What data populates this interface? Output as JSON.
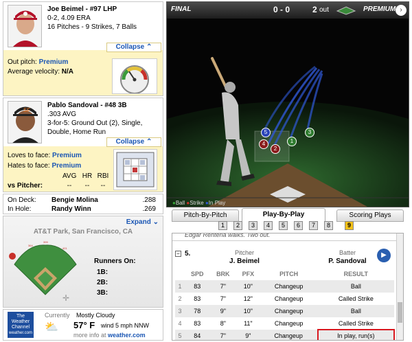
{
  "pitcher": {
    "name": "Joe Beimel - #97 LHP",
    "record": "0-2, 4.09 ERA",
    "pitches": "16 Pitches - 9 Strikes, 7 Balls",
    "collapse": "Collapse",
    "out_pitch_label": "Out pitch:",
    "out_pitch_value": "Premium",
    "velocity_label": "Average velocity:",
    "velocity_value": "N/A"
  },
  "batter": {
    "name": "Pablo Sandoval - #48 3B",
    "avg": ".303 AVG",
    "line1": "3-for-5: Ground Out (2), Single,",
    "line2": "Double, Home Run",
    "collapse": "Collapse",
    "loves_label": "Loves to face:",
    "loves_value": "Premium",
    "hates_label": "Hates to face:",
    "hates_value": "Premium",
    "stat_headers": [
      "AVG",
      "HR",
      "RBI"
    ],
    "vs_label": "vs Pitcher:",
    "vs_values": [
      "--",
      "--",
      "--"
    ]
  },
  "on_deck": {
    "label": "On Deck:",
    "name": "Bengie Molina",
    "avg": ".288"
  },
  "in_hole": {
    "label": "In Hole:",
    "name": "Randy Winn",
    "avg": ".269"
  },
  "park": {
    "expand": "Expand",
    "name": "AT&T Park, San Francisco, CA",
    "runners_title": "Runners On:",
    "bases": [
      "1B:",
      "2B:",
      "3B:"
    ]
  },
  "weather": {
    "logo_line1": "The",
    "logo_line2": "Weather",
    "logo_line3": "Channel",
    "logo_url": "weather.com",
    "currently": "Currently",
    "condition": "Mostly Cloudy",
    "temp": "57° F",
    "wind": "wind 5 mph NNW",
    "more_prefix": "more info at",
    "more_link": "weather.com"
  },
  "game": {
    "status": "FINAL",
    "score": "0 - 0",
    "outs": "2",
    "outs_label": "out",
    "premium": "PREMIUM"
  },
  "pitch_markers": [
    "1",
    "2",
    "3",
    "4",
    "5"
  ],
  "legend": [
    "Ball",
    "Strike",
    "In Play"
  ],
  "tabs": [
    "Pitch-By-Pitch",
    "Play-By-Play",
    "Scoring Plays"
  ],
  "inning_buttons": [
    "1",
    "2",
    "3",
    "4",
    "5",
    "6",
    "7",
    "8",
    "9"
  ],
  "play": {
    "prev_text": "Edgar Renteria walks. Two out.",
    "number": "5.",
    "pitcher_label": "Pitcher",
    "pitcher_name": "J. Beimel",
    "batter_label": "Batter",
    "batter_name": "P. Sandoval",
    "columns": [
      "SPD",
      "BRK",
      "PFX",
      "PITCH",
      "RESULT"
    ],
    "rows": [
      {
        "n": "1",
        "spd": "83",
        "brk": "7\"",
        "pfx": "10\"",
        "pitch": "Changeup",
        "result": "Ball"
      },
      {
        "n": "2",
        "spd": "83",
        "brk": "7\"",
        "pfx": "12\"",
        "pitch": "Changeup",
        "result": "Called Strike"
      },
      {
        "n": "3",
        "spd": "78",
        "brk": "9\"",
        "pfx": "10\"",
        "pitch": "Changeup",
        "result": "Ball"
      },
      {
        "n": "4",
        "spd": "83",
        "brk": "8\"",
        "pfx": "11\"",
        "pitch": "Changeup",
        "result": "Called Strike"
      },
      {
        "n": "5",
        "spd": "84",
        "brk": "7\"",
        "pfx": "9\"",
        "pitch": "Changeup",
        "result": "In play, run(s)"
      }
    ]
  }
}
